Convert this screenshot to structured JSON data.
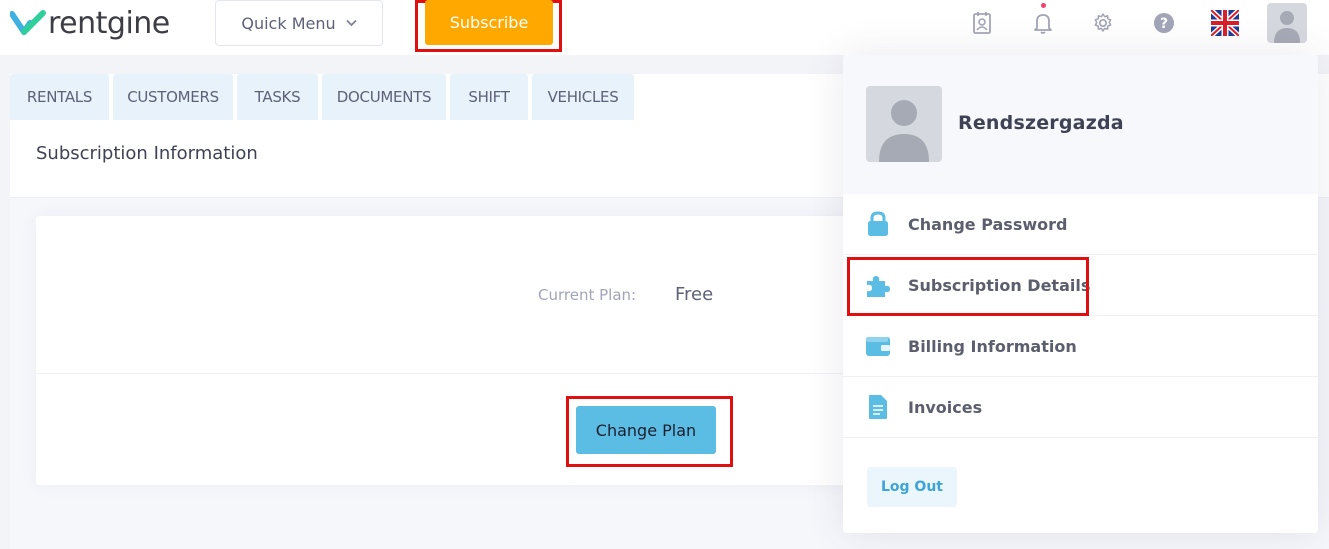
{
  "header": {
    "logo_text": "rentgine",
    "quick_menu_label": "Quick Menu",
    "subscribe_label": "Subscribe",
    "icons": [
      "contact-book-icon",
      "bell-icon",
      "gear-icon",
      "help-icon",
      "uk-flag-icon",
      "user-avatar-icon"
    ]
  },
  "tabs": [
    {
      "label": "RENTALS"
    },
    {
      "label": "CUSTOMERS"
    },
    {
      "label": "TASKS"
    },
    {
      "label": "DOCUMENTS"
    },
    {
      "label": "SHIFT"
    },
    {
      "label": "VEHICLES"
    }
  ],
  "page": {
    "title": "Subscription Information",
    "current_plan_label": "Current Plan:",
    "current_plan_value": "Free",
    "change_plan_label": "Change Plan"
  },
  "user_menu": {
    "user_name": "Rendszergazda",
    "items": [
      {
        "label": "Change Password",
        "icon": "lock-icon"
      },
      {
        "label": "Subscription Details",
        "icon": "puzzle-icon"
      },
      {
        "label": "Billing Information",
        "icon": "wallet-icon"
      },
      {
        "label": "Invoices",
        "icon": "document-icon"
      }
    ],
    "logout_label": "Log Out"
  },
  "colors": {
    "accent": "#5bbde4",
    "subscribe": "#ffa800",
    "highlight": "#e01010"
  }
}
